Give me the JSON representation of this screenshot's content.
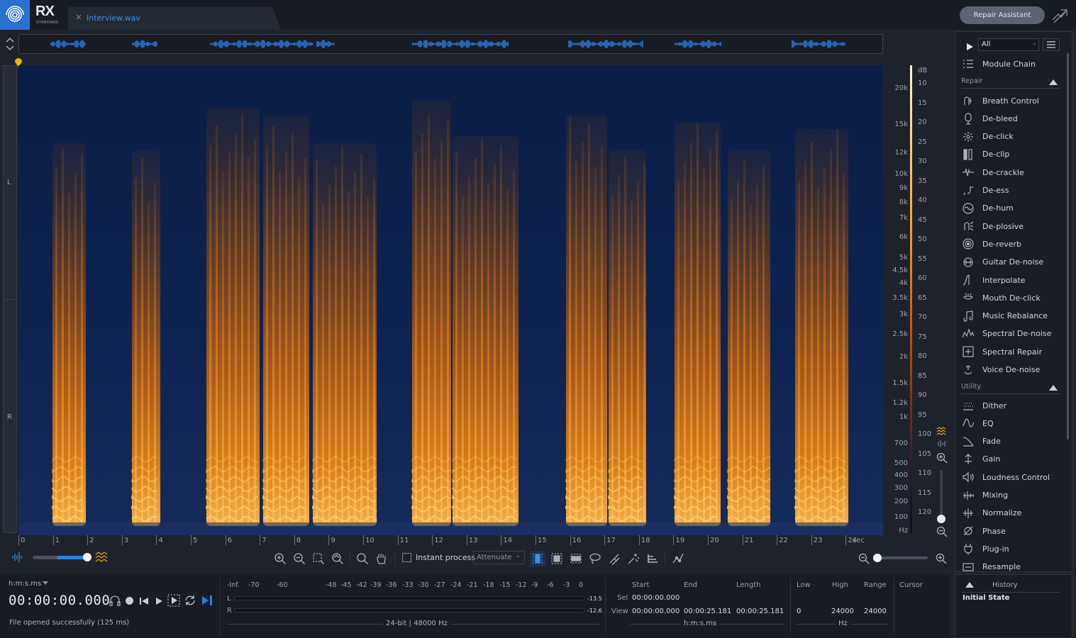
{
  "app": {
    "name": "RX",
    "edition": "STANDARD"
  },
  "file_tab": {
    "name": "Interview.wav",
    "close": "×"
  },
  "header": {
    "repair_assistant": "Repair Assistant"
  },
  "channels": {
    "left": "L",
    "right": "R"
  },
  "freq_scale": [
    "20k",
    "15k",
    "12k",
    "10k",
    "9k",
    "8k",
    "7k",
    "6k",
    "5k",
    "4.5k",
    "4k",
    "3.5k",
    "3k",
    "2.5k",
    "2k",
    "1.5k",
    "1.2k",
    "1k",
    "700",
    "500",
    "400",
    "300",
    "200",
    "100",
    "Hz"
  ],
  "db_scale": [
    "dB",
    "10",
    "15",
    "20",
    "25",
    "30",
    "35",
    "40",
    "45",
    "50",
    "55",
    "60",
    "65",
    "70",
    "75",
    "80",
    "85",
    "90",
    "95",
    "100",
    "105",
    "110",
    "115",
    "120"
  ],
  "time_ticks": [
    "0",
    "1",
    "2",
    "3",
    "4",
    "5",
    "6",
    "7",
    "8",
    "9",
    "10",
    "11",
    "12",
    "13",
    "14",
    "15",
    "16",
    "17",
    "18",
    "19",
    "20",
    "21",
    "22",
    "23",
    "24",
    "sec"
  ],
  "toolbar": {
    "instant_process": "Instant process",
    "mode": "Attenuate"
  },
  "transport": {
    "time_format": "h:m:s.ms",
    "timecode": "00:00:00.000",
    "status": "File opened successfully (125 ms)"
  },
  "meter": {
    "scale": [
      "-Inf.",
      "-70",
      "-60",
      "-48",
      "-45",
      "-42",
      "-39",
      "-36",
      "-33",
      "-30",
      "-27",
      "-24",
      "-21",
      "-18",
      "-15",
      "-12",
      "-9",
      "-6",
      "-3",
      "0"
    ],
    "left_label": "L",
    "right_label": "R",
    "left_peak": "-13.5",
    "right_peak": "-12.6",
    "format": "24-bit | 48000 Hz"
  },
  "selection": {
    "headers": {
      "start": "Start",
      "end": "End",
      "length": "Length"
    },
    "sel_label": "Sel",
    "view_label": "View",
    "sel_start": "00:00:00.000",
    "view_start": "00:00:00.000",
    "view_end": "00:00:25.181",
    "view_length": "00:00:25.181",
    "unit": "h:m:s.ms"
  },
  "freq_range": {
    "headers": {
      "low": "Low",
      "high": "High",
      "range": "Range"
    },
    "low": "0",
    "high": "24000",
    "range": "24000",
    "unit": "Hz"
  },
  "cursor": {
    "label": "Cursor"
  },
  "modules": {
    "filter": "All",
    "module_chain": "Module Chain",
    "repair_section": "Repair",
    "repair": [
      {
        "label": "Breath Control",
        "icon": "breath-icon"
      },
      {
        "label": "De-bleed",
        "icon": "debleed-icon"
      },
      {
        "label": "De-click",
        "icon": "declick-icon"
      },
      {
        "label": "De-clip",
        "icon": "declip-icon"
      },
      {
        "label": "De-crackle",
        "icon": "decrackle-icon"
      },
      {
        "label": "De-ess",
        "icon": "deess-icon"
      },
      {
        "label": "De-hum",
        "icon": "dehum-icon"
      },
      {
        "label": "De-plosive",
        "icon": "deplosive-icon"
      },
      {
        "label": "De-reverb",
        "icon": "dereverb-icon"
      },
      {
        "label": "Guitar De-noise",
        "icon": "guitar-icon"
      },
      {
        "label": "Interpolate",
        "icon": "interpolate-icon"
      },
      {
        "label": "Mouth De-click",
        "icon": "mouth-icon"
      },
      {
        "label": "Music Rebalance",
        "icon": "music-icon"
      },
      {
        "label": "Spectral De-noise",
        "icon": "spectral-denoise-icon"
      },
      {
        "label": "Spectral Repair",
        "icon": "spectral-repair-icon"
      },
      {
        "label": "Voice De-noise",
        "icon": "voice-icon"
      }
    ],
    "utility_section": "Utility",
    "utility": [
      {
        "label": "Dither",
        "icon": "dither-icon"
      },
      {
        "label": "EQ",
        "icon": "eq-icon"
      },
      {
        "label": "Fade",
        "icon": "fade-icon"
      },
      {
        "label": "Gain",
        "icon": "gain-icon"
      },
      {
        "label": "Loudness Control",
        "icon": "loudness-icon"
      },
      {
        "label": "Mixing",
        "icon": "mixing-icon"
      },
      {
        "label": "Normalize",
        "icon": "normalize-icon"
      },
      {
        "label": "Phase",
        "icon": "phase-icon"
      },
      {
        "label": "Plug-in",
        "icon": "plugin-icon"
      },
      {
        "label": "Resample",
        "icon": "resample-icon"
      }
    ]
  },
  "history": {
    "title": "History",
    "items": [
      "Initial State"
    ]
  },
  "colors": {
    "accent": "#2b6fd1",
    "tab_text": "#3d8fe6",
    "spectro_low": "#0a1b3d",
    "spectro_high": "#ffb238"
  }
}
